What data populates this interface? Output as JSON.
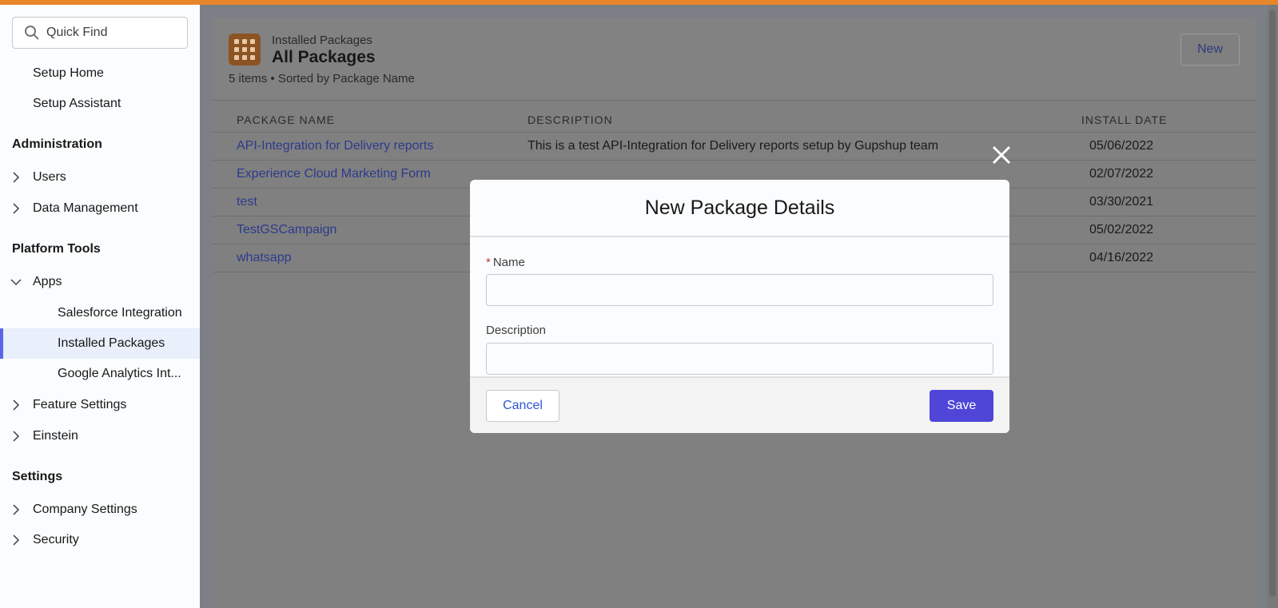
{
  "sidebar": {
    "search_placeholder": "Quick Find",
    "setup_home": "Setup Home",
    "setup_assistant": "Setup Assistant",
    "administration": "Administration",
    "users": "Users",
    "data_management": "Data Management",
    "platform_tools": "Platform Tools",
    "apps": "Apps",
    "salesforce_integration": "Salesforce Integration",
    "installed_packages": "Installed Packages",
    "google_analytics": "Google Analytics Int...",
    "feature_settings": "Feature Settings",
    "einstein": "Einstein",
    "settings": "Settings",
    "company_settings": "Company Settings",
    "security": "Security"
  },
  "header": {
    "subtitle": "Installed Packages",
    "title": "All Packages",
    "meta": "5 items • Sorted by Package Name",
    "new_label": "New"
  },
  "table": {
    "columns": [
      "PACKAGE NAME",
      "DESCRIPTION",
      "INSTALL DATE"
    ],
    "rows": [
      {
        "name": "API-Integration for Delivery reports",
        "description": "This is a test API-Integration for Delivery reports setup by Gupshup team",
        "date": "05/06/2022"
      },
      {
        "name": "Experience Cloud Marketing Form",
        "description": "",
        "date": "02/07/2022"
      },
      {
        "name": "test",
        "description": "",
        "date": "03/30/2021"
      },
      {
        "name": "TestGSCampaign",
        "description": "",
        "date": "05/02/2022"
      },
      {
        "name": "whatsapp",
        "description": "",
        "date": "04/16/2022"
      }
    ]
  },
  "modal": {
    "title": "New Package Details",
    "name_label": "Name",
    "required_mark": "*",
    "description_label": "Description",
    "name_value": "",
    "description_value": "",
    "cancel_label": "Cancel",
    "save_label": "Save"
  },
  "colors": {
    "accent": "#e8852a",
    "primary_button": "#4f46d8",
    "selected_border": "#5867e8"
  }
}
